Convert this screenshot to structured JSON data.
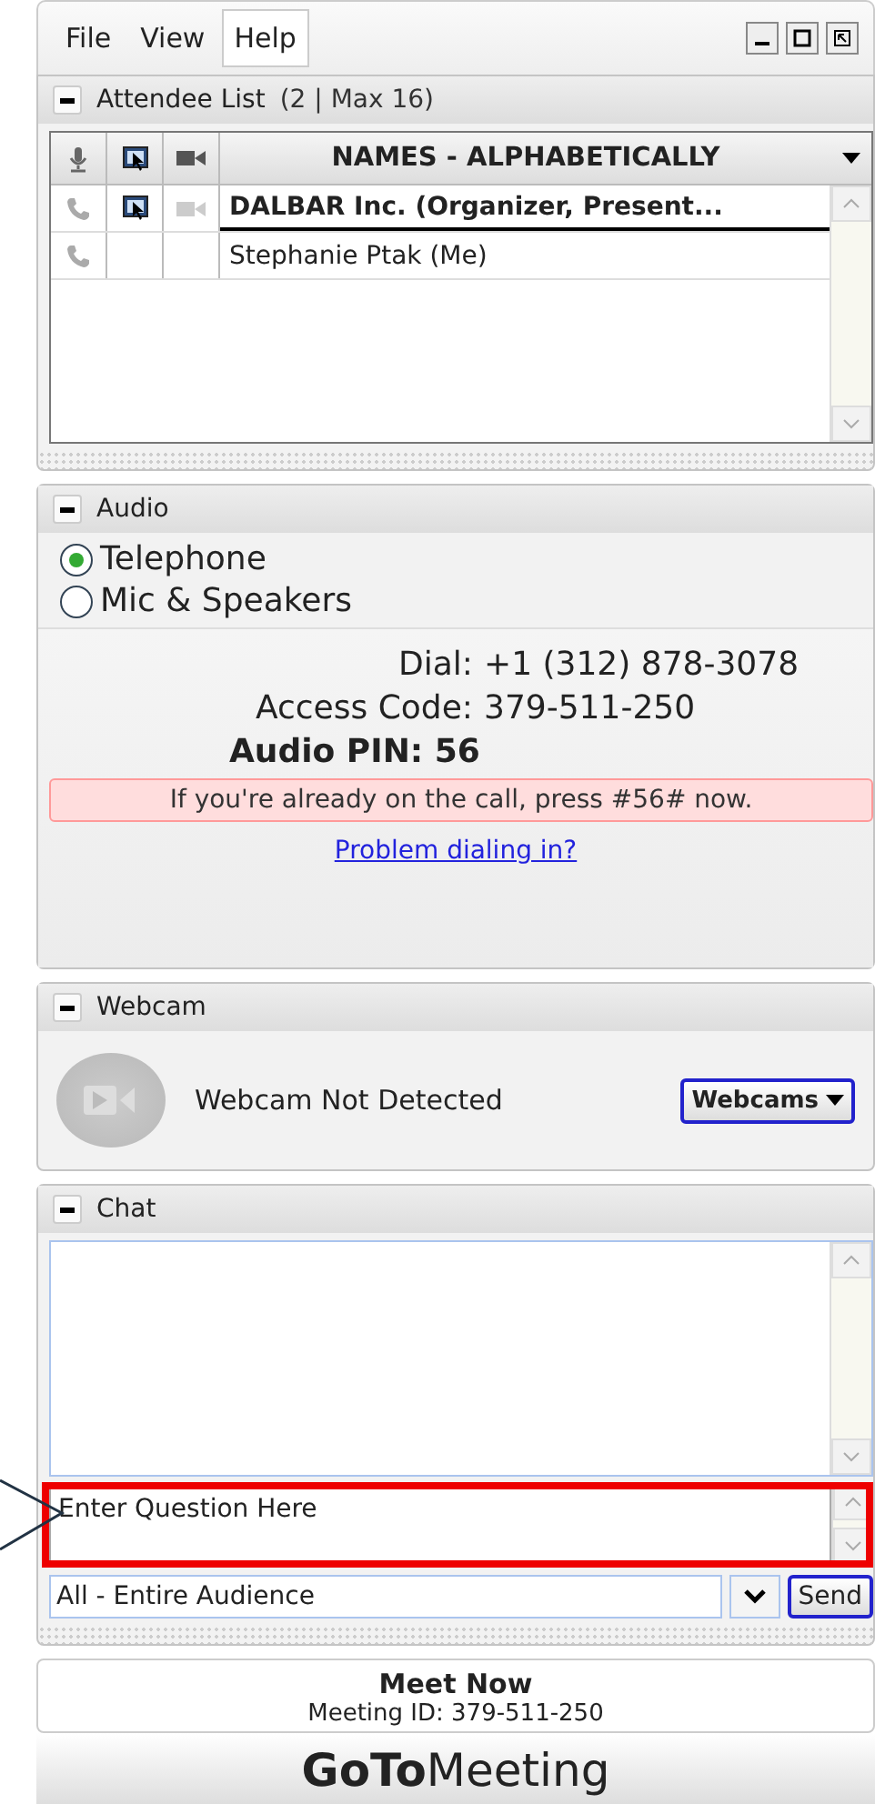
{
  "menu": [
    {
      "label": "File",
      "selected": false
    },
    {
      "label": "View",
      "selected": false
    },
    {
      "label": "Help",
      "selected": true
    }
  ],
  "attendee_list": {
    "title": "Attendee List",
    "count": "(2 | Max 16)",
    "column_header": "NAMES - ALPHABETICALLY",
    "rows": [
      {
        "name": "DALBAR Inc. (Organizer, Present...",
        "screen_sharing": true,
        "webcam": true,
        "bold": true
      },
      {
        "name": "Stephanie Ptak (Me)",
        "screen_sharing": false,
        "webcam": false,
        "bold": false
      }
    ]
  },
  "audio": {
    "title": "Audio",
    "options": [
      {
        "label": "Telephone",
        "selected": true
      },
      {
        "label": "Mic & Speakers",
        "selected": false
      }
    ],
    "dial_label": "Dial:",
    "dial": "+1 (312) 878-3078",
    "access_label": "Access Code:",
    "access_code": "379-511-250",
    "pin": "Audio PIN: 56",
    "notice": "If you're already on the call, press #56# now.",
    "link": "Problem dialing in?"
  },
  "webcam": {
    "title": "Webcam",
    "status": "Webcam Not Detected",
    "button": "Webcams"
  },
  "chat": {
    "title": "Chat",
    "question": {
      "value": "Enter Question Here",
      "highlighted": true
    },
    "recipient": "All - Entire Audience",
    "send": "Send"
  },
  "footer": {
    "title": "Meet Now",
    "meeting_id": "Meeting ID: 379-511-250",
    "logo": "**GoTo**Meeting"
  }
}
